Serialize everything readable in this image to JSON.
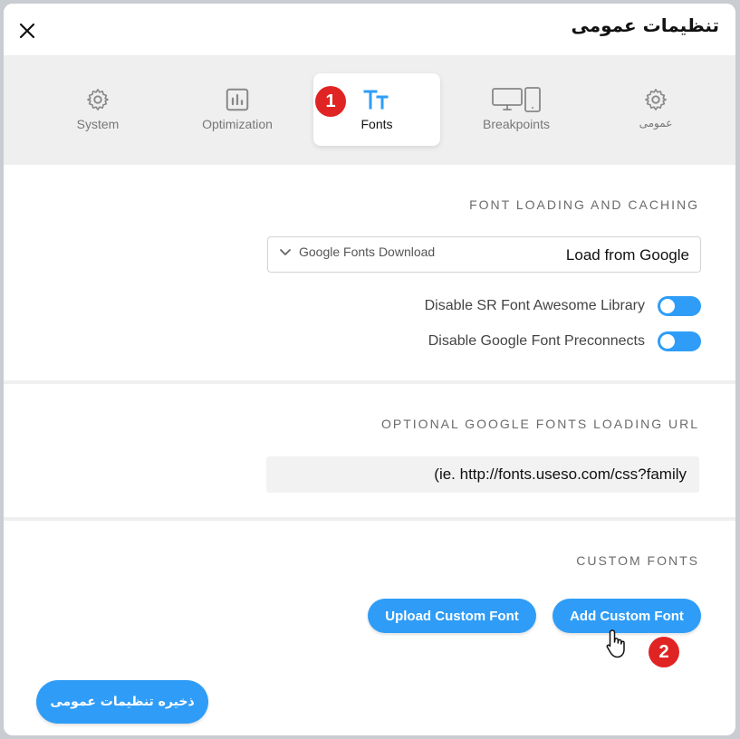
{
  "header": {
    "title": "تنظیمات عمومی"
  },
  "tabs": [
    {
      "label": "System",
      "icon": "gear-icon"
    },
    {
      "label": "Optimization",
      "icon": "bar-chart-icon"
    },
    {
      "label": "Fonts",
      "icon": "font-size-icon",
      "active": true
    },
    {
      "label": "Breakpoints",
      "icon": "devices-icon"
    },
    {
      "label": "عمومی",
      "icon": "gear-icon"
    }
  ],
  "annotations": {
    "step1": "1",
    "step2": "2"
  },
  "font_loading": {
    "title": "FONT LOADING AND CACHING",
    "select_value": "Load from Google",
    "select_option": "Google Fonts Download",
    "toggles": [
      {
        "label": "Disable SR Font Awesome Library",
        "on": true
      },
      {
        "label": "Disable Google Font Preconnects",
        "on": true
      }
    ]
  },
  "google_url": {
    "title": "OPTIONAL GOOGLE FONTS LOADING URL",
    "value": "(ie. http://fonts.useso.com/css?family"
  },
  "custom_fonts": {
    "title": "CUSTOM FONTS",
    "upload_label": "Upload Custom Font",
    "add_label": "Add Custom Font"
  },
  "footer": {
    "save_label": "ذخیره تنظیمات عمومی"
  },
  "colors": {
    "accent": "#2f9df7",
    "badge": "#e02424",
    "tab_bg": "#efefef"
  }
}
